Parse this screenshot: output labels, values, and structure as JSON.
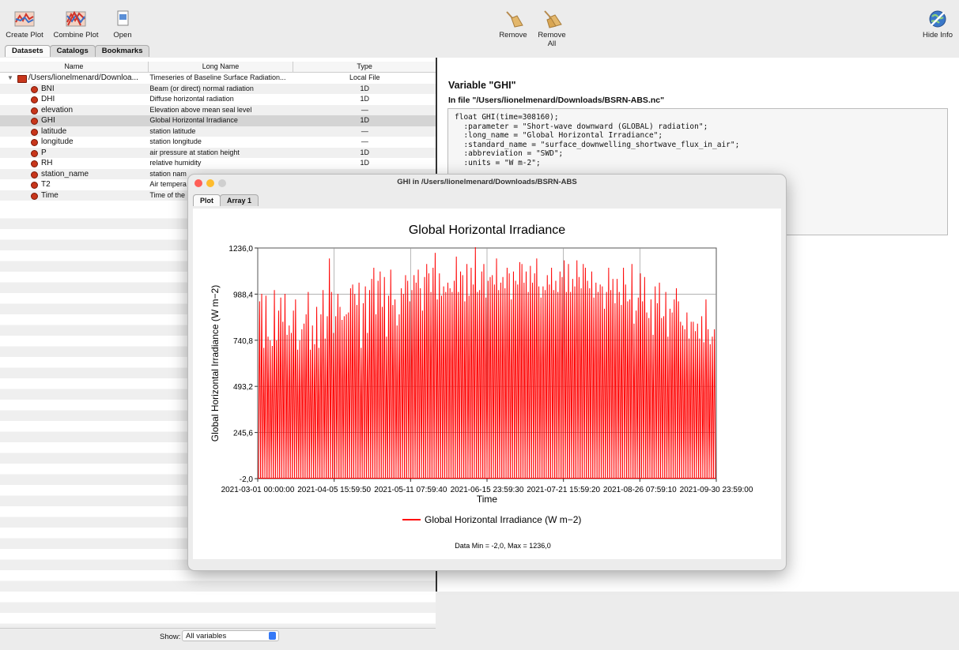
{
  "toolbar": {
    "left": [
      {
        "label": "Create Plot",
        "icon": "create-plot-icon"
      },
      {
        "label": "Combine Plot",
        "icon": "combine-plot-icon"
      },
      {
        "label": "Open",
        "icon": "open-icon"
      }
    ],
    "remove_label": "Remove",
    "remove_all_label": "Remove All",
    "hide_info_label": "Hide Info"
  },
  "tabs": [
    "Datasets",
    "Catalogs",
    "Bookmarks"
  ],
  "table": {
    "headers": [
      "Name",
      "Long Name",
      "Type"
    ],
    "dataset": {
      "name": "/Users/lionelmenard/Downloa...",
      "long": "Timeseries of Baseline Surface Radiation...",
      "type": "Local File"
    },
    "rows": [
      {
        "name": "BNI",
        "long": "Beam (or direct) normal radiation",
        "type": "1D"
      },
      {
        "name": "DHI",
        "long": "Diffuse horizontal radiation",
        "type": "1D"
      },
      {
        "name": "elevation",
        "long": "Elevation above mean seal level",
        "type": "—"
      },
      {
        "name": "GHI",
        "long": "Global Horizontal Irradiance",
        "type": "1D"
      },
      {
        "name": "latitude",
        "long": "station latitude",
        "type": "—"
      },
      {
        "name": "longitude",
        "long": "station longitude",
        "type": "—"
      },
      {
        "name": "P",
        "long": "air pressure at station height",
        "type": "1D"
      },
      {
        "name": "RH",
        "long": "relative humidity",
        "type": "1D"
      },
      {
        "name": "station_name",
        "long": "station nam",
        "type": ""
      },
      {
        "name": "T2",
        "long": "Air tempera",
        "type": ""
      },
      {
        "name": "Time",
        "long": "Time of the",
        "type": ""
      }
    ]
  },
  "show": {
    "label": "Show:",
    "value": "All variables"
  },
  "info": {
    "title": "Variable \"GHI\"",
    "file": "In file \"/Users/lionelmenard/Downloads/BSRN-ABS.nc\"",
    "code_lines": [
      "float GHI(time=308160);",
      "  :parameter = \"Short-wave downward (GLOBAL) radiation\";",
      "  :long_name = \"Global Horizontal Irradiance\";",
      "  :standard_name = \"surface_downwelling_shortwave_flux_in_air\";",
      "  :abbreviation = \"SWD\";",
      "  :units = \"W m-2\";"
    ]
  },
  "plot_window": {
    "title": "GHI in /Users/lionelmenard/Downloads/BSRN-ABS",
    "tabs": [
      "Plot",
      "Array 1"
    ]
  },
  "chart_data": {
    "type": "line",
    "title": "Global Horizontal Irradiance",
    "xlabel": "Time",
    "ylabel": "Global Horizontal Irradiance (W m−2)",
    "legend": "Global Horizontal Irradiance (W m−2)",
    "footer": "Data Min = -2,0, Max = 1236,0",
    "yticks": [
      "-2,0",
      "245,6",
      "493,2",
      "740,8",
      "988,4",
      "1236,0"
    ],
    "ylim": [
      -2.0,
      1236.0
    ],
    "xticks": [
      "2021-03-01 00:00:00",
      "2021-04-05 15:59:50",
      "2021-05-11 07:59:40",
      "2021-06-15 23:59:30",
      "2021-07-21 15:59:20",
      "2021-08-26 07:59:10",
      "2021-09-30 23:59:00"
    ],
    "xlim": [
      "2021-03-01 00:00:00",
      "2021-09-30 23:59:00"
    ],
    "grid": true,
    "legend_position": "bottom",
    "series_color": "#ff0000",
    "series": [
      {
        "name": "Global Horizontal Irradiance (W m−2)",
        "daily_peaks": [
          950,
          990,
          700,
          980,
          760,
          740,
          710,
          1010,
          740,
          900,
          970,
          840,
          990,
          770,
          820,
          780,
          900,
          960,
          690,
          740,
          800,
          830,
          880,
          1000,
          690,
          820,
          720,
          920,
          700,
          880,
          1010,
          750,
          870,
          1180,
          1000,
          780,
          870,
          990,
          920,
          850,
          870,
          880,
          890,
          1020,
          1040,
          990,
          930,
          1050,
          700,
          940,
          1030,
          780,
          1010,
          1070,
          1130,
          880,
          1060,
          1110,
          920,
          1080,
          760,
          980,
          1120,
          930,
          960,
          820,
          880,
          1020,
          990,
          1090,
          1060,
          950,
          1010,
          1090,
          1050,
          1120,
          1020,
          900,
          1080,
          1150,
          1100,
          1000,
          1130,
          1210,
          960,
          1100,
          980,
          1030,
          1000,
          1050,
          1020,
          1000,
          1060,
          1190,
          1000,
          1110,
          1090,
          950,
          1150,
          980,
          1130,
          1040,
          1240,
          1000,
          1010,
          1110,
          1150,
          970,
          1060,
          1080,
          1090,
          1040,
          1180,
          1010,
          1050,
          1080,
          1020,
          1130,
          1100,
          960,
          1110,
          1060,
          1040,
          1160,
          1150,
          1050,
          1110,
          1000,
          1140,
          1050,
          1100,
          1180,
          1030,
          970,
          1030,
          1010,
          1090,
          1040,
          1130,
          1010,
          1060,
          1000,
          1110,
          1080,
          1170,
          1000,
          1150,
          1000,
          1070,
          1030,
          1170,
          1080,
          1020,
          1150,
          1130,
          1060,
          1020,
          1110,
          970,
          1050,
          1000,
          1040,
          1030,
          910,
          1000,
          1130,
          1010,
          1070,
          940,
          1070,
          1000,
          930,
          1130,
          1040,
          950,
          960,
          1150,
          830,
          900,
          970,
          1100,
          950,
          1080,
          890,
          860,
          960,
          770,
          1030,
          940,
          1050,
          860,
          870,
          1000,
          760,
          910,
          890,
          960,
          1020,
          950,
          840,
          820,
          800,
          890,
          750,
          840,
          840,
          790,
          830,
          750,
          870,
          730,
          960,
          800,
          720,
          760,
          800
        ]
      }
    ]
  }
}
